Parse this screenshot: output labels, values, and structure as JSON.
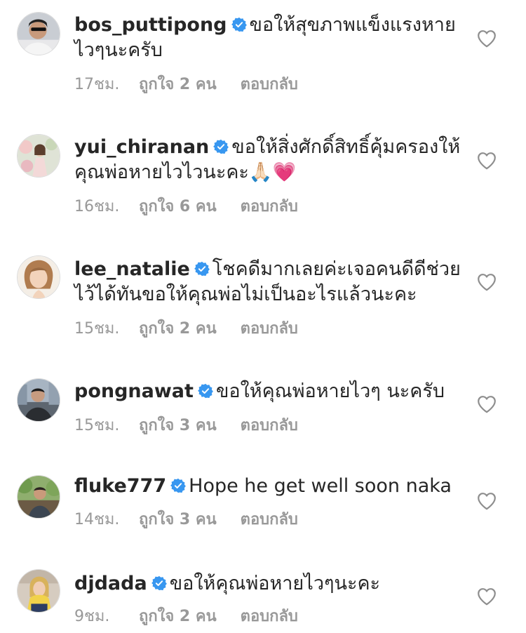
{
  "comments": [
    {
      "username": "bos_puttipong",
      "text": "ขอให้สุขภาพแข็งแรงหายไวๆนะครับ",
      "time": "17ชม.",
      "likes": "ถูกใจ 2 คน",
      "reply": "ตอบกลับ"
    },
    {
      "username": "yui_chiranan",
      "text": "ขอให้สิ่งศักดิ์สิทธิ์คุ้มครองให้คุณพ่อหายไวไวนะคะ🙏🏻💗",
      "time": "16ชม.",
      "likes": "ถูกใจ 6 คน",
      "reply": "ตอบกลับ"
    },
    {
      "username": "lee_natalie",
      "text": "โชคดีมากเลยค่ะเจอคนดีดีช่วยไว้ได้ทันขอให้คุณพ่อไม่เป็นอะไรแล้วนะคะ",
      "time": "15ชม.",
      "likes": "ถูกใจ 2 คน",
      "reply": "ตอบกลับ"
    },
    {
      "username": "pongnawat",
      "text": "ขอให้คุณพ่อหายไวๆ นะครับ",
      "time": "15ชม.",
      "likes": "ถูกใจ 3 คน",
      "reply": "ตอบกลับ"
    },
    {
      "username": "fluke777",
      "text": "Hope he get well soon naka",
      "time": "14ชม.",
      "likes": "ถูกใจ 3 คน",
      "reply": "ตอบกลับ"
    },
    {
      "username": "djdada",
      "text": "ขอให้คุณพ่อหายไวๆนะคะ",
      "time": "9ชม.",
      "likes": "ถูกใจ 2 คน",
      "reply": "ตอบกลับ"
    }
  ],
  "icons": {
    "verified": "verified-badge-icon",
    "like": "heart-outline-icon"
  },
  "colors": {
    "text": "#262626",
    "meta": "#999999",
    "verified": "#3897f0",
    "heart_outline": "#8e8e8e"
  }
}
